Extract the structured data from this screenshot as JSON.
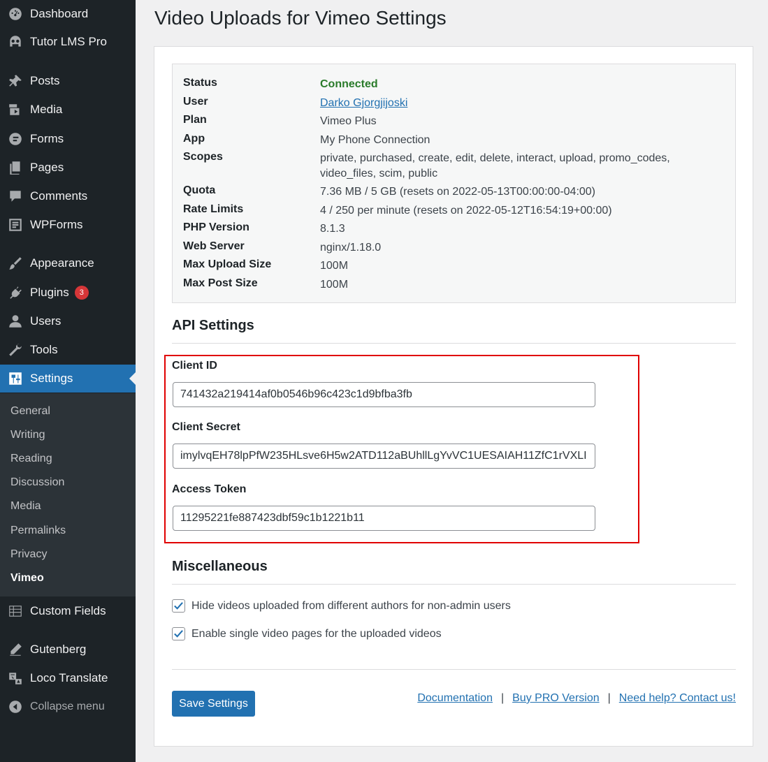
{
  "sidebar": {
    "items": [
      {
        "label": "Dashboard",
        "icon": "dashboard-icon"
      },
      {
        "label": "Tutor LMS Pro",
        "icon": "tutor-owl-icon"
      },
      {
        "label": "Posts",
        "icon": "pin-icon"
      },
      {
        "label": "Media",
        "icon": "media-icon"
      },
      {
        "label": "Forms",
        "icon": "forms-icon"
      },
      {
        "label": "Pages",
        "icon": "pages-icon"
      },
      {
        "label": "Comments",
        "icon": "comment-icon"
      },
      {
        "label": "WPForms",
        "icon": "wpforms-icon"
      },
      {
        "label": "Appearance",
        "icon": "paintbrush-icon"
      },
      {
        "label": "Plugins",
        "icon": "plugin-icon",
        "badge": "3"
      },
      {
        "label": "Users",
        "icon": "user-icon"
      },
      {
        "label": "Tools",
        "icon": "wrench-icon"
      },
      {
        "label": "Settings",
        "icon": "settings-sliders-icon"
      },
      {
        "label": "Custom Fields",
        "icon": "grid-icon"
      },
      {
        "label": "Gutenberg",
        "icon": "pencil-icon"
      },
      {
        "label": "Loco Translate",
        "icon": "translate-icon"
      },
      {
        "label": "Collapse menu",
        "icon": "collapse-arrow-icon"
      }
    ],
    "submenu": [
      "General",
      "Writing",
      "Reading",
      "Discussion",
      "Media",
      "Permalinks",
      "Privacy",
      "Vimeo"
    ]
  },
  "page": {
    "title": "Video Uploads for Vimeo Settings"
  },
  "status": {
    "rows": [
      {
        "key": "Status",
        "value": "Connected"
      },
      {
        "key": "User",
        "value": "Darko Gjorgjijoski"
      },
      {
        "key": "Plan",
        "value": "Vimeo Plus"
      },
      {
        "key": "App",
        "value": "My Phone Connection"
      },
      {
        "key": "Scopes",
        "value": "private, purchased, create, edit, delete, interact, upload, promo_codes, video_files, scim, public"
      },
      {
        "key": "Quota",
        "value": "7.36 MB / 5 GB (resets on 2022-05-13T00:00:00-04:00)"
      },
      {
        "key": "Rate Limits",
        "value": "4 / 250 per minute (resets on 2022-05-12T16:54:19+00:00)"
      },
      {
        "key": "PHP Version",
        "value": "8.1.3"
      },
      {
        "key": "Web Server",
        "value": "nginx/1.18.0"
      },
      {
        "key": "Max Upload Size",
        "value": "100M"
      },
      {
        "key": "Max Post Size",
        "value": "100M"
      }
    ]
  },
  "api": {
    "heading": "API Settings",
    "client_id_label": "Client ID",
    "client_id_value": "741432a219414af0b0546b96c423c1d9bfba3fb",
    "client_secret_label": "Client Secret",
    "client_secret_value": "imylvqEH78lpPfW235HLsve6H5w2ATD112aBUhllLgYvVC1UESAIAH11ZfC1rVXLI",
    "access_token_label": "Access Token",
    "access_token_value": "11295221fe887423dbf59c1b1221b11"
  },
  "misc": {
    "heading": "Miscellaneous",
    "option1": "Hide videos uploaded from different authors for non-admin users",
    "option2": "Enable single video pages for the uploaded videos"
  },
  "footer": {
    "save_label": "Save Settings",
    "documentation": "Documentation",
    "buy_pro": "Buy PRO Version",
    "help": "Need help? Contact us!",
    "separator": "|"
  },
  "colors": {
    "sidebar_bg": "#1d2327",
    "accent": "#2271b1",
    "connected": "#2a7b2a",
    "highlight": "#e00000"
  }
}
